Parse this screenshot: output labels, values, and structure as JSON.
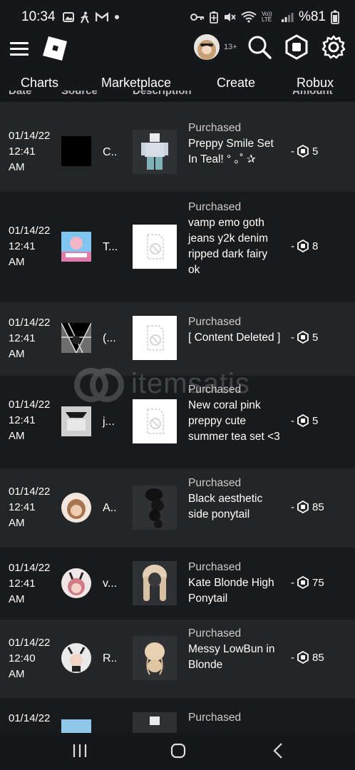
{
  "status_bar": {
    "time": "10:34",
    "left_icons": [
      "gallery-icon",
      "walking-icon",
      "gmail-icon",
      "dot-icon"
    ],
    "right_icons": [
      "key-icon",
      "battery-saver-icon",
      "mute-icon",
      "wifi-icon",
      "volte-icon",
      "signal-icon"
    ],
    "network_label": "Vo)) LTE",
    "battery": "%81"
  },
  "header": {
    "age_badge": "13+"
  },
  "tabs": [
    "Charts",
    "Marketplace",
    "Create",
    "Robux"
  ],
  "columns": {
    "date": "Date",
    "source": "Source",
    "description": "Description",
    "amount": "Amount"
  },
  "transactions": [
    {
      "date": "01/14/22",
      "time": "12:41",
      "ampm": "AM",
      "source": "C..",
      "kind": "Purchased",
      "item": "Preppy Smile Set In Teal! ° ｡˚ ✰",
      "amount": "5"
    },
    {
      "date": "01/14/22",
      "time": "12:41",
      "ampm": "AM",
      "source": "T...",
      "kind": "Purchased",
      "item": "vamp emo goth jeans y2k denim ripped dark fairy ok",
      "amount": "8"
    },
    {
      "date": "01/14/22",
      "time": "12:41",
      "ampm": "AM",
      "source": "(...",
      "kind": "Purchased",
      "item": "[ Content Deleted ]",
      "amount": "5"
    },
    {
      "date": "01/14/22",
      "time": "12:41",
      "ampm": "AM",
      "source": "j...",
      "kind": "Purchased",
      "item": "New coral pink preppy cute summer tea set <3",
      "amount": "5"
    },
    {
      "date": "01/14/22",
      "time": "12:41",
      "ampm": "AM",
      "source": "A..",
      "kind": "Purchased",
      "item": "Black aesthetic side ponytail",
      "amount": "85"
    },
    {
      "date": "01/14/22",
      "time": "12:41",
      "ampm": "AM",
      "source": "v...",
      "kind": "Purchased",
      "item": "Kate Blonde High Ponytail",
      "amount": "75"
    },
    {
      "date": "01/14/22",
      "time": "12:40",
      "ampm": "AM",
      "source": "R..",
      "kind": "Purchased",
      "item": "Messy LowBun in Blonde",
      "amount": "85"
    },
    {
      "date": "01/14/22",
      "time": "",
      "ampm": "",
      "source": "",
      "kind": "Purchased",
      "item": "",
      "amount": ""
    }
  ],
  "amount_prefix": "-",
  "watermark": "itemsatis"
}
